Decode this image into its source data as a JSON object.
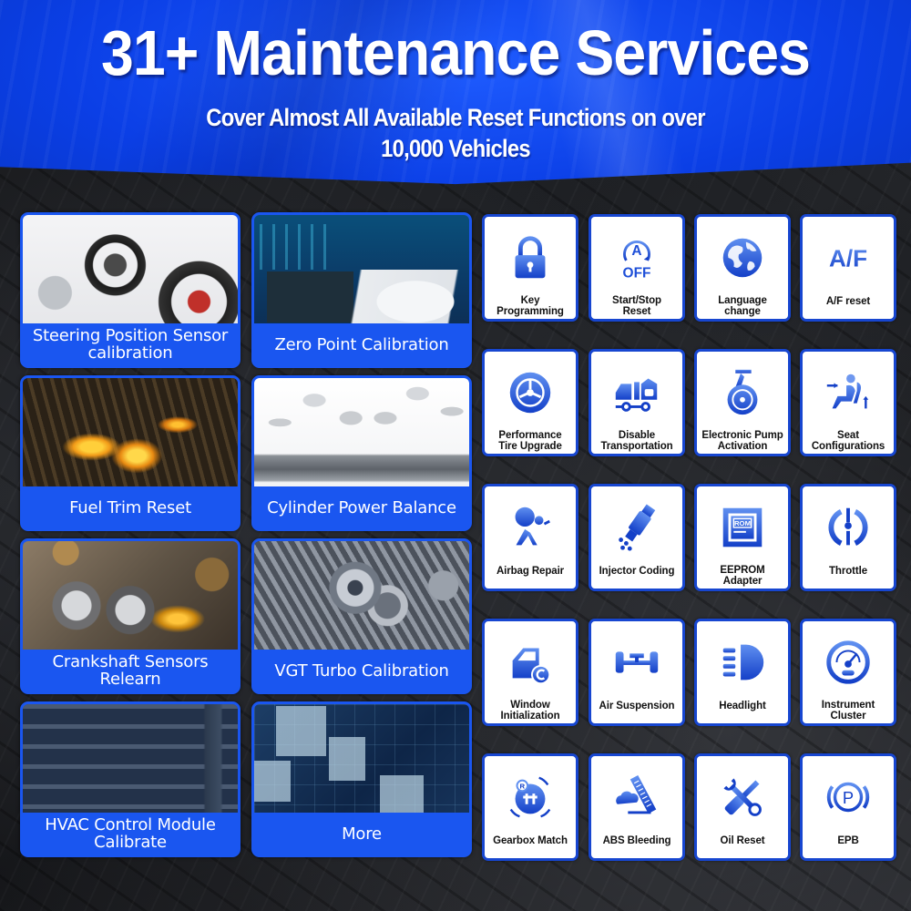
{
  "header": {
    "title": "31+ Maintenance Services",
    "subtitle_line1": "Cover Almost All Available Reset Functions on over",
    "subtitle_line2": "10,000 Vehicles"
  },
  "colors": {
    "brand_blue": "#1a56f0",
    "header_blue": "#0b3fe6",
    "icon_blue": "#1746d0",
    "card_bg": "#ffffff",
    "text_dark": "#111111"
  },
  "photo_cards": [
    {
      "label": "Steering Position Sensor calibration",
      "image": "steering-wheel-suspension-photo"
    },
    {
      "label": "Zero Point Calibration",
      "image": "scan-tool-and-suv-photo"
    },
    {
      "label": "Fuel Trim Reset",
      "image": "engine-combustion-photo"
    },
    {
      "label": "Cylinder Power Balance",
      "image": "pistons-crankshaft-photo"
    },
    {
      "label": "Crankshaft Sensors Relearn",
      "image": "crankshaft-gears-oil-photo"
    },
    {
      "label": "VGT Turbo Calibration",
      "image": "turbocharger-photo"
    },
    {
      "label": "HVAC Control Module Calibrate",
      "image": "air-vent-photo"
    },
    {
      "label": "More",
      "image": "digital-dashboard-photo"
    }
  ],
  "icon_cards": [
    {
      "label": "Key\nProgramming",
      "icon": "padlock-icon"
    },
    {
      "label": "Start/Stop\nReset",
      "icon": "auto-start-stop-off-icon"
    },
    {
      "label": "Language\nchange",
      "icon": "globe-icon"
    },
    {
      "label": "A/F reset",
      "icon": "air-fuel-icon"
    },
    {
      "label": "Performance\nTire Upgrade",
      "icon": "tire-icon"
    },
    {
      "label": "Disable\nTransportation",
      "icon": "transport-truck-icon"
    },
    {
      "label": "Electronic Pump\nActivation",
      "icon": "pump-icon"
    },
    {
      "label": "Seat\nConfigurations",
      "icon": "seat-adjust-icon"
    },
    {
      "label": "Airbag Repair",
      "icon": "airbag-icon"
    },
    {
      "label": "Injector Coding",
      "icon": "injector-icon"
    },
    {
      "label": "EEPROM\nAdapter",
      "icon": "rom-chip-icon"
    },
    {
      "label": "Throttle",
      "icon": "throttle-icon"
    },
    {
      "label": "Window\nInitialization",
      "icon": "car-door-window-icon"
    },
    {
      "label": "Air Suspension",
      "icon": "axle-suspension-icon"
    },
    {
      "label": "Headlight",
      "icon": "headlight-icon"
    },
    {
      "label": "Instrument\nCluster",
      "icon": "gauge-icon"
    },
    {
      "label": "Gearbox Match",
      "icon": "gearbox-icon"
    },
    {
      "label": "ABS Bleeding",
      "icon": "brake-bleeding-icon"
    },
    {
      "label": "Oil Reset",
      "icon": "wrench-screwdriver-icon"
    },
    {
      "label": "EPB",
      "icon": "parking-brake-icon"
    }
  ]
}
